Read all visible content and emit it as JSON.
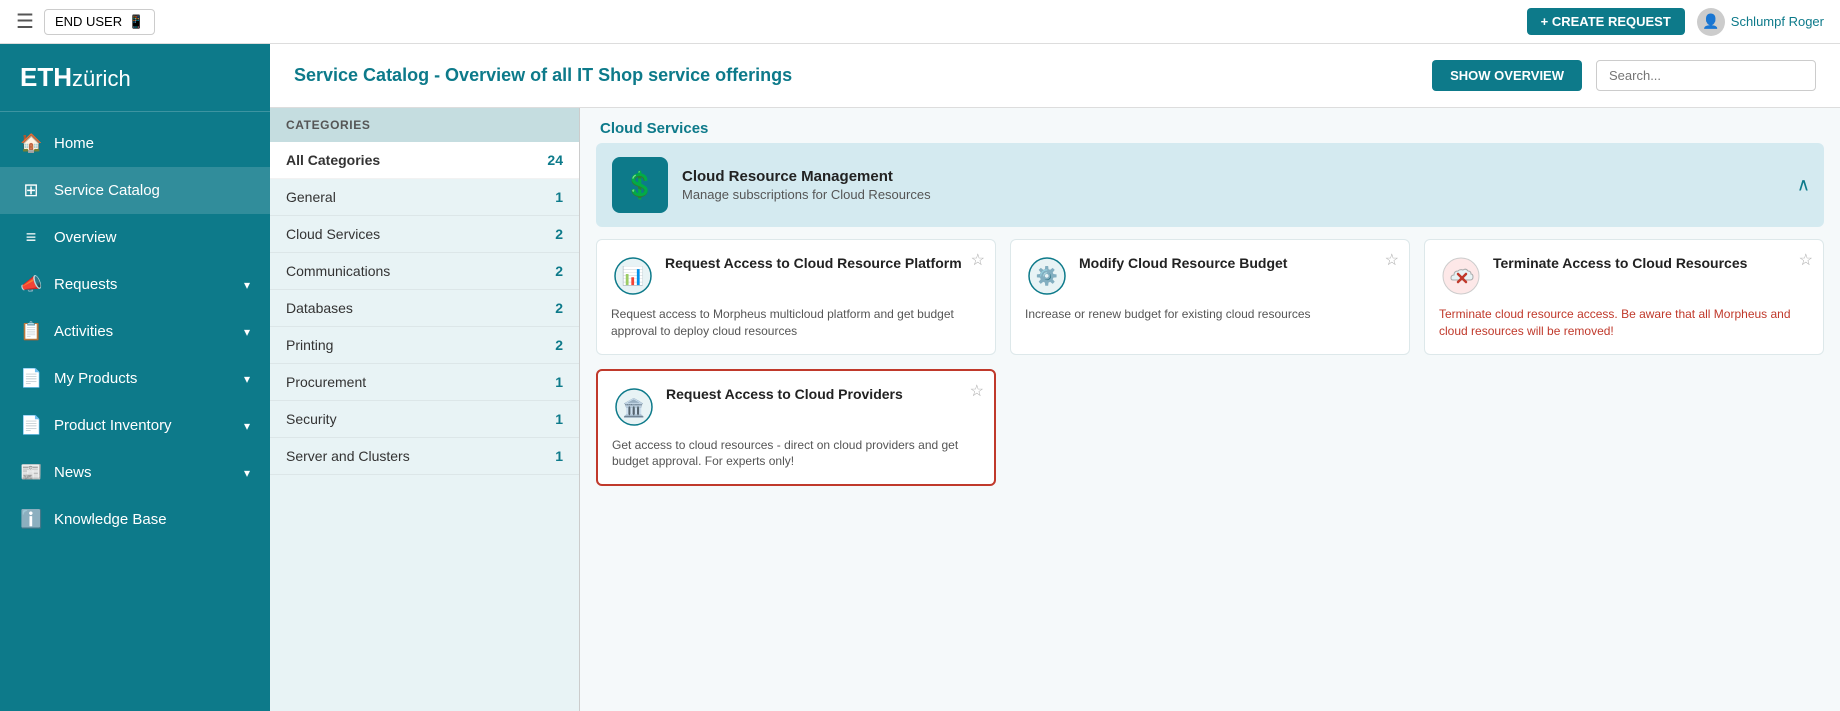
{
  "topbar": {
    "hamburger": "☰",
    "end_user_label": "END USER",
    "end_user_icon": "📱",
    "create_request_label": "+ CREATE REQUEST",
    "user_name": "Schlumpf Roger"
  },
  "sidebar": {
    "logo_eth": "ETH",
    "logo_zurich": "zürich",
    "items": [
      {
        "id": "home",
        "label": "Home",
        "icon": "🏠",
        "has_chevron": false
      },
      {
        "id": "service-catalog",
        "label": "Service Catalog",
        "icon": "⊞",
        "has_chevron": false,
        "active": true
      },
      {
        "id": "overview",
        "label": "Overview",
        "icon": "≡",
        "has_chevron": false
      },
      {
        "id": "requests",
        "label": "Requests",
        "icon": "📣",
        "has_chevron": true
      },
      {
        "id": "activities",
        "label": "Activities",
        "icon": "📋",
        "has_chevron": true
      },
      {
        "id": "my-products",
        "label": "My Products",
        "icon": "📄",
        "has_chevron": true
      },
      {
        "id": "product-inventory",
        "label": "Product Inventory",
        "icon": "📄",
        "has_chevron": true
      },
      {
        "id": "news",
        "label": "News",
        "icon": "📰",
        "has_chevron": true
      },
      {
        "id": "knowledge-base",
        "label": "Knowledge Base",
        "icon": "ℹ️",
        "has_chevron": false
      }
    ]
  },
  "page_header": {
    "title": "Service Catalog - Overview of all IT Shop service offerings",
    "show_overview_label": "SHOW OVERVIEW",
    "search_placeholder": "Search..."
  },
  "categories": {
    "header_label": "CATEGORIES",
    "items": [
      {
        "id": "all",
        "label": "All Categories",
        "count": "24",
        "active": true
      },
      {
        "id": "general",
        "label": "General",
        "count": "1"
      },
      {
        "id": "cloud-services",
        "label": "Cloud Services",
        "count": "2"
      },
      {
        "id": "communications",
        "label": "Communications",
        "count": "2"
      },
      {
        "id": "databases",
        "label": "Databases",
        "count": "2"
      },
      {
        "id": "printing",
        "label": "Printing",
        "count": "2"
      },
      {
        "id": "procurement",
        "label": "Procurement",
        "count": "1"
      },
      {
        "id": "security",
        "label": "Security",
        "count": "1"
      },
      {
        "id": "server-clusters",
        "label": "Server and Clusters",
        "count": "1"
      }
    ]
  },
  "services": {
    "section_label": "Cloud Services",
    "featured": {
      "title": "Cloud Resource Management",
      "description": "Manage subscriptions for Cloud Resources",
      "icon": "💲"
    },
    "cards": [
      {
        "id": "request-access-cloud-resource",
        "title": "Request Access to Cloud Resource Platform",
        "description": "Request access to Morpheus multicloud platform and get budget approval to deploy cloud resources",
        "icon": "📊",
        "selected": false,
        "star": "☆"
      },
      {
        "id": "modify-cloud-resource-budget",
        "title": "Modify Cloud Resource Budget",
        "description": "Increase or renew budget for existing cloud resources",
        "icon": "⚙️",
        "selected": false,
        "star": "☆"
      },
      {
        "id": "terminate-access-cloud-resources",
        "title": "Terminate Access to Cloud Resources",
        "description": "Terminate cloud resource access. Be aware that all Morpheus and cloud resources will be removed!",
        "icon": "☁️",
        "selected": false,
        "star": "☆",
        "desc_red": true
      },
      {
        "id": "request-access-cloud-providers",
        "title": "Request Access to Cloud Providers",
        "description": "Get access to cloud resources - direct on cloud providers and get budget approval. For experts only!",
        "icon": "🏛️",
        "selected": true,
        "star": "☆"
      }
    ]
  }
}
